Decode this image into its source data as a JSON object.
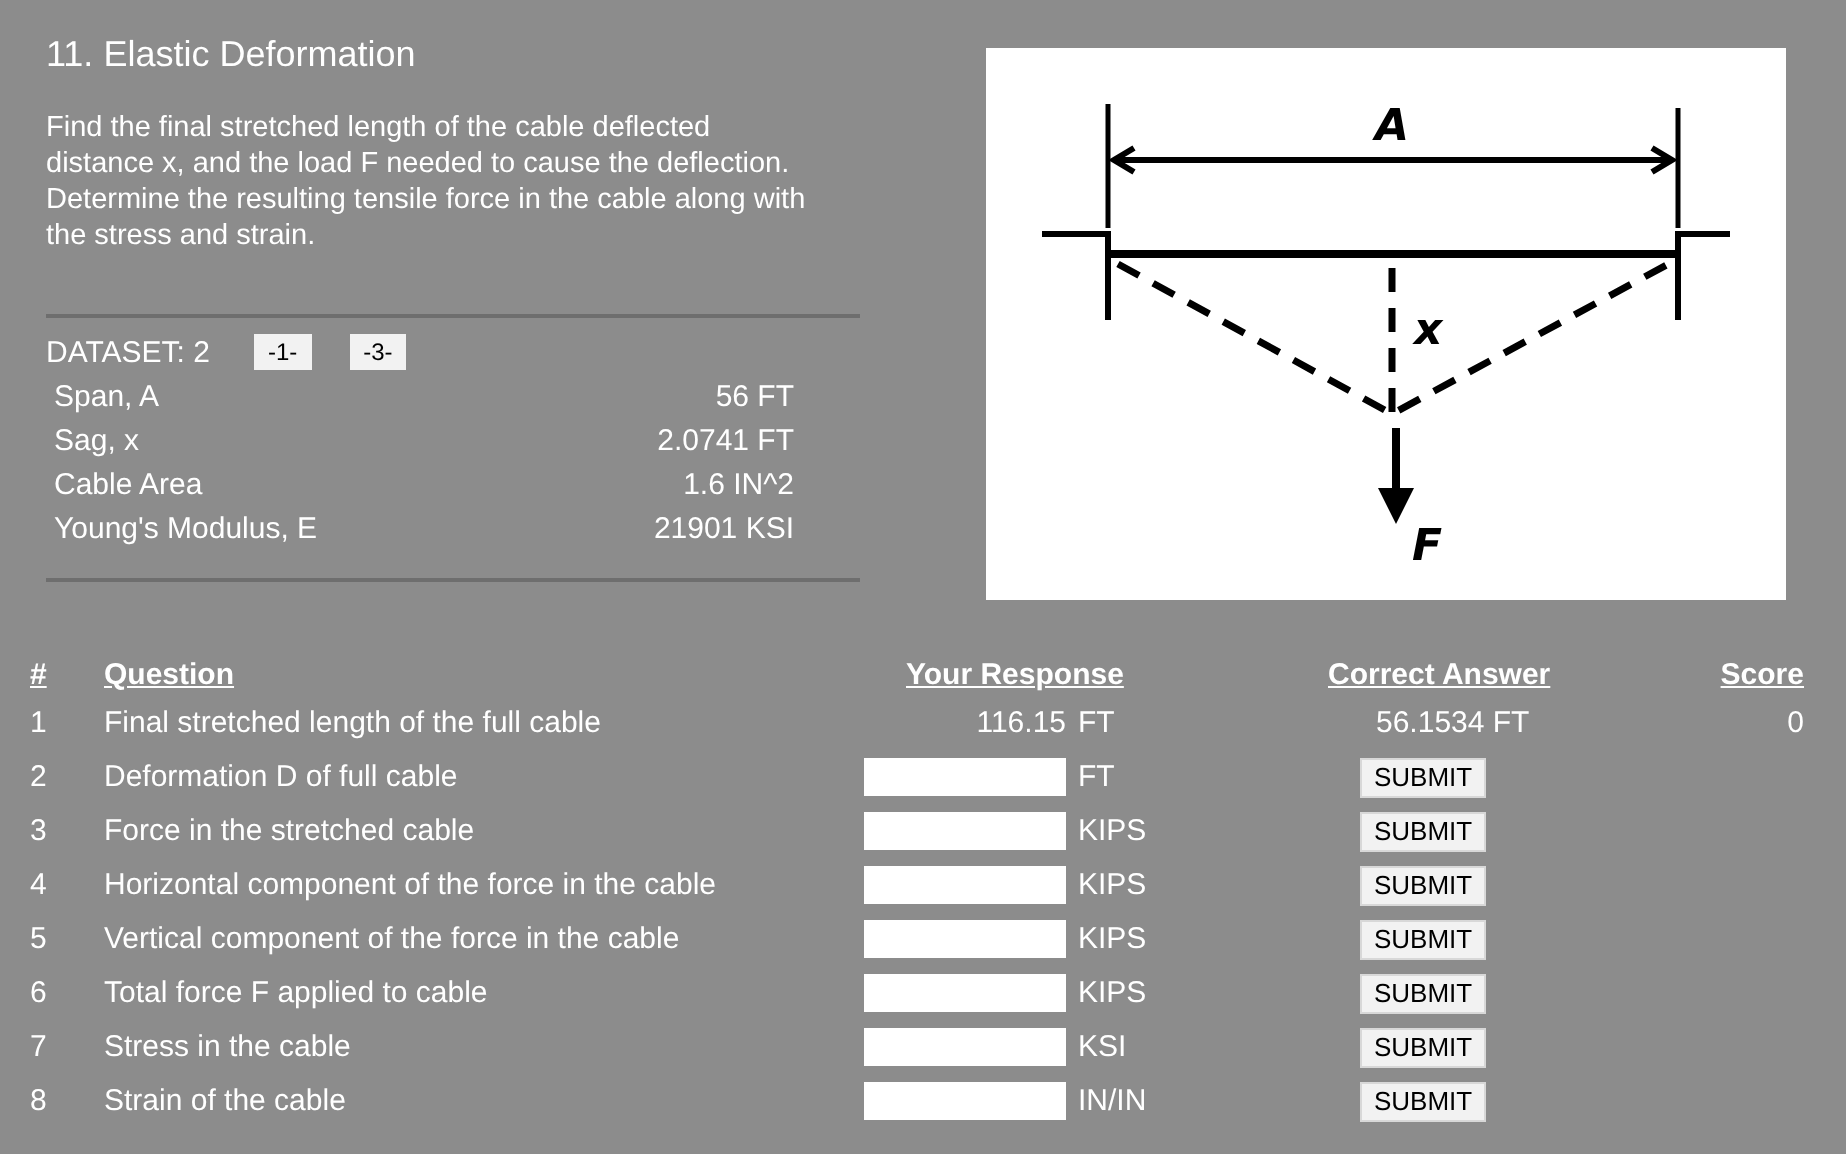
{
  "title": "11. Elastic Deformation",
  "description": "Find the final stretched length of the cable deflected distance x, and the load F needed to cause the deflection. Determine the resulting tensile force in the cable along with the stress and strain.",
  "dataset": {
    "label": "DATASET: 2",
    "buttons": [
      "-1-",
      "-3-"
    ],
    "values": [
      {
        "name": "Span, A",
        "value": "56 FT"
      },
      {
        "name": "Sag, x",
        "value": "2.0741 FT"
      },
      {
        "name": "Cable Area",
        "value": "1.6 IN^2"
      },
      {
        "name": "Young's Modulus, E",
        "value": "21901 KSI"
      }
    ]
  },
  "diagram": {
    "span_label": "A",
    "sag_label": "x",
    "force_label": "F"
  },
  "table": {
    "columns": [
      "#",
      "Question",
      "Your Response",
      "Correct Answer",
      "Score"
    ],
    "rows": [
      {
        "kind": "answered",
        "number": "1",
        "question": "Final stretched length of the full cable",
        "response": "116.15",
        "unit": "FT",
        "correct_answer": "56.1534 FT",
        "score": "0"
      },
      {
        "kind": "input",
        "number": "2",
        "question": "Deformation D of full cable",
        "unit": "FT",
        "button": "SUBMIT"
      },
      {
        "kind": "input",
        "number": "3",
        "question": "Force in the stretched cable",
        "unit": "KIPS",
        "button": "SUBMIT"
      },
      {
        "kind": "input",
        "number": "4",
        "question": "Horizontal component of the force in the cable",
        "unit": "KIPS",
        "button": "SUBMIT"
      },
      {
        "kind": "input",
        "number": "5",
        "question": "Vertical component of the force in the cable",
        "unit": "KIPS",
        "button": "SUBMIT"
      },
      {
        "kind": "input",
        "number": "6",
        "question": "Total force F applied to cable",
        "unit": "KIPS",
        "button": "SUBMIT"
      },
      {
        "kind": "input",
        "number": "7",
        "question": "Stress in the cable",
        "unit": "KSI",
        "button": "SUBMIT"
      },
      {
        "kind": "input",
        "number": "8",
        "question": "Strain of the cable",
        "unit": "IN/IN",
        "button": "SUBMIT"
      }
    ]
  }
}
